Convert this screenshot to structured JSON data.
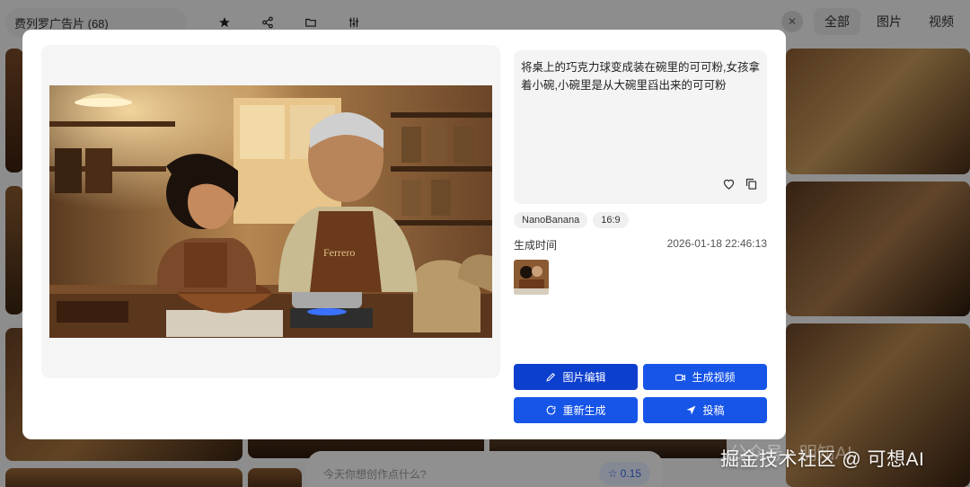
{
  "topbar": {
    "collection": "费列罗广告片 (68)",
    "icons": [
      "star-icon",
      "share-icon",
      "folder-icon",
      "sliders-icon"
    ],
    "filters": [
      "全部",
      "图片",
      "视频"
    ],
    "active_filter": "全部"
  },
  "composer": {
    "placeholder": "今天你想创作点什么?",
    "cost": "0.15"
  },
  "modal": {
    "prompt": "将桌上的巧克力球变成装在碗里的可可粉,女孩拿着小碗,小碗里是从大碗里舀出来的可可粉",
    "tags": [
      "NanoBanana",
      "16:9"
    ],
    "meta_label": "生成时间",
    "meta_value": "2026-01-18 22:46:13",
    "buttons": {
      "edit": "图片编辑",
      "video": "生成视频",
      "regen": "重新生成",
      "submit": "投稿"
    }
  },
  "watermark": {
    "text": "掘金技术社区 @ 可想AI",
    "ghost": "公众号 · 明知AI"
  },
  "colors": {
    "primary": "#1755e8",
    "primary_dark": "#0d3fcf"
  }
}
